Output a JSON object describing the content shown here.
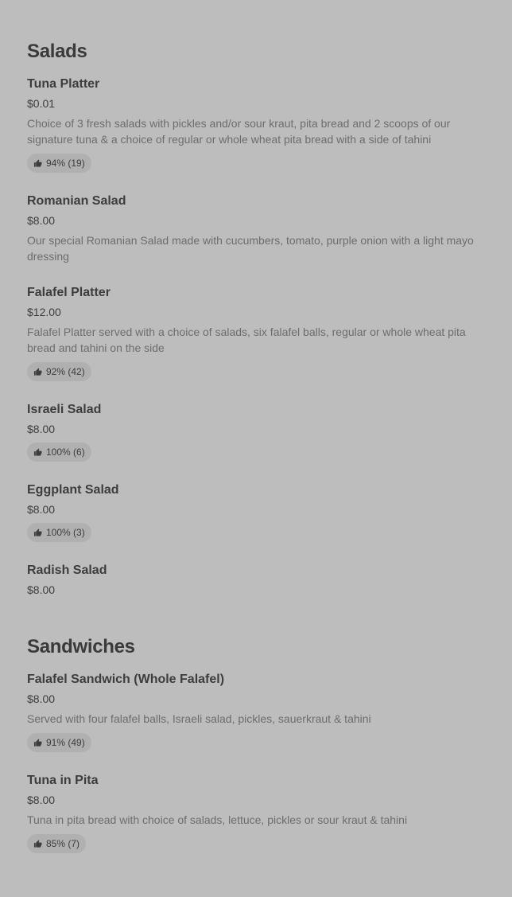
{
  "sections": [
    {
      "title": "Salads",
      "items": [
        {
          "name": "Tuna Platter",
          "price": "$0.01",
          "description": "Choice of 3 fresh salads with pickles and/or sour kraut, pita bread and 2 scoops of our signature tuna & a choice of regular or whole wheat pita bread with a side of tahini",
          "rating": "94% (19)"
        },
        {
          "name": "Romanian Salad",
          "price": "$8.00",
          "description": "Our special Romanian Salad made with cucumbers, tomato, purple onion with a light mayo dressing",
          "rating": null
        },
        {
          "name": "Falafel Platter",
          "price": "$12.00",
          "description": "Falafel Platter served with a choice of salads, six falafel balls, regular or whole wheat pita bread and tahini on the side",
          "rating": "92% (42)"
        },
        {
          "name": "Israeli Salad",
          "price": "$8.00",
          "description": null,
          "rating": "100% (6)"
        },
        {
          "name": "Eggplant Salad",
          "price": "$8.00",
          "description": null,
          "rating": "100% (3)"
        },
        {
          "name": "Radish Salad",
          "price": "$8.00",
          "description": null,
          "rating": null
        }
      ]
    },
    {
      "title": "Sandwiches",
      "items": [
        {
          "name": "Falafel Sandwich (Whole Falafel)",
          "price": "$8.00",
          "description": "Served with four falafel balls, Israeli salad, pickles, sauerkraut & tahini",
          "rating": "91% (49)"
        },
        {
          "name": "Tuna in Pita",
          "price": "$8.00",
          "description": "Tuna in pita bread with choice of salads, lettuce, pickles or sour kraut & tahini",
          "rating": "85% (7)"
        }
      ]
    }
  ],
  "icons": {
    "rating": "thumbs-up-icon"
  }
}
